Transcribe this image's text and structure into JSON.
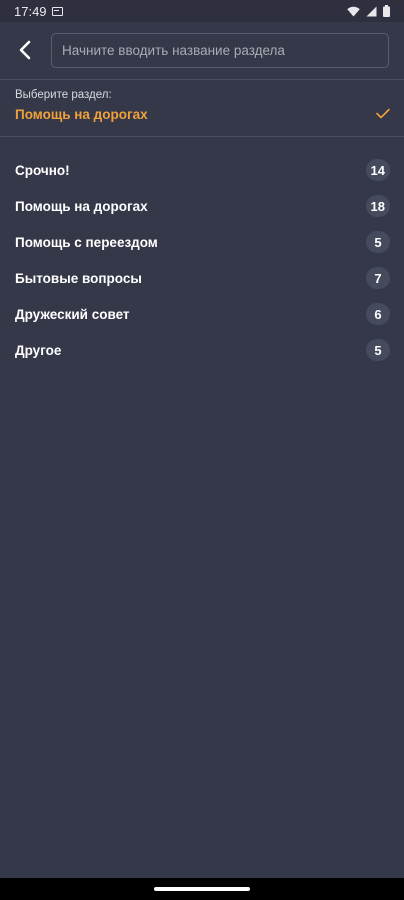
{
  "status_bar": {
    "time": "17:49"
  },
  "search": {
    "placeholder": "Начните вводить название раздела"
  },
  "section": {
    "caption": "Выберите раздел:",
    "selected": "Помощь на дорогах",
    "accent_color": "#f0a13a"
  },
  "categories": [
    {
      "label": "Срочно!",
      "count": "14"
    },
    {
      "label": "Помощь на дорогах",
      "count": "18"
    },
    {
      "label": "Помощь с переездом",
      "count": "5"
    },
    {
      "label": "Бытовые вопросы",
      "count": "7"
    },
    {
      "label": "Дружеский совет",
      "count": "6"
    },
    {
      "label": "Другое",
      "count": "5"
    }
  ],
  "icons": {
    "back": "arrow-left-icon",
    "check": "check-icon",
    "wifi": "wifi-icon",
    "signal": "signal-icon",
    "battery": "battery-icon",
    "notification": "notification-icon"
  }
}
